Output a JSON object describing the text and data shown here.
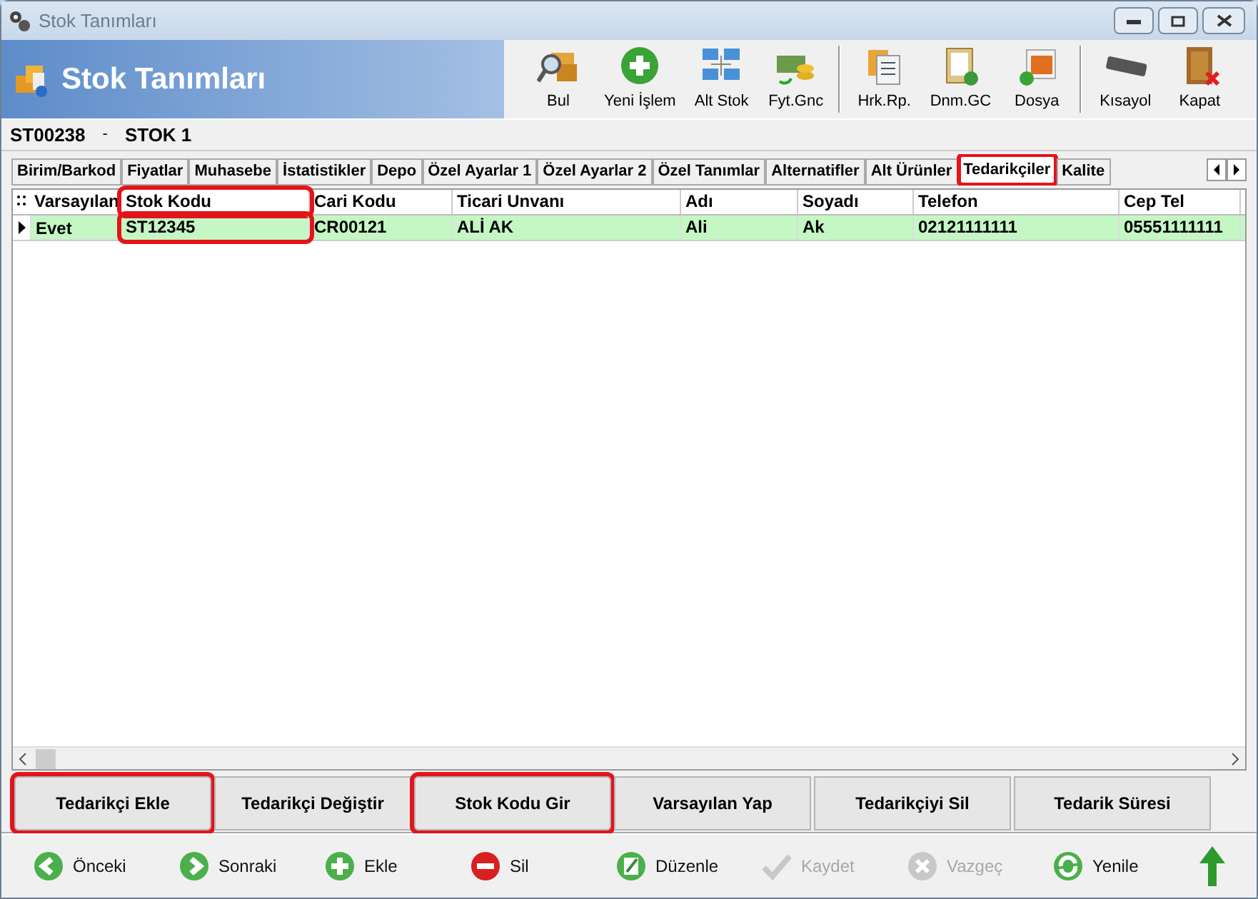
{
  "window": {
    "title": "Stok Tanımları"
  },
  "header": {
    "title": "Stok Tanımları"
  },
  "toolbar": [
    {
      "label": "Bul"
    },
    {
      "label": "Yeni İşlem"
    },
    {
      "label": "Alt Stok"
    },
    {
      "label": "Fyt.Gnc"
    },
    {
      "label": "Hrk.Rp."
    },
    {
      "label": "Dnm.GC"
    },
    {
      "label": "Dosya"
    },
    {
      "label": "Kısayol"
    },
    {
      "label": "Kapat"
    }
  ],
  "record": {
    "code": "ST00238",
    "separator": "-",
    "name": "STOK 1"
  },
  "tabs": [
    {
      "label": "Birim/Barkod",
      "selected": false
    },
    {
      "label": "Fiyatlar",
      "selected": false
    },
    {
      "label": "Muhasebe",
      "selected": false
    },
    {
      "label": "İstatistikler",
      "selected": false
    },
    {
      "label": "Depo",
      "selected": false
    },
    {
      "label": "Özel Ayarlar 1",
      "selected": false
    },
    {
      "label": "Özel Ayarlar 2",
      "selected": false
    },
    {
      "label": "Özel Tanımlar",
      "selected": false
    },
    {
      "label": "Alternatifler",
      "selected": false
    },
    {
      "label": "Alt Ürünler",
      "selected": false
    },
    {
      "label": "Tedarikçiler",
      "selected": true,
      "highlighted": true
    },
    {
      "label": "Kalite",
      "selected": false
    }
  ],
  "table": {
    "columns": [
      {
        "label": "Varsayılan",
        "highlighted": false
      },
      {
        "label": "Stok Kodu",
        "highlighted": true
      },
      {
        "label": "Cari Kodu",
        "highlighted": false
      },
      {
        "label": "Ticari Unvanı",
        "highlighted": false
      },
      {
        "label": "Adı",
        "highlighted": false
      },
      {
        "label": "Soyadı",
        "highlighted": false
      },
      {
        "label": "Telefon",
        "highlighted": false
      },
      {
        "label": "Cep Tel",
        "highlighted": false
      }
    ],
    "rows": [
      {
        "selected": true,
        "cells": [
          "Evet",
          "ST12345",
          "CR00121",
          "ALİ AK",
          "Ali",
          "Ak",
          "02121111111",
          "05551111111"
        ]
      }
    ]
  },
  "actions": [
    {
      "label": "Tedarikçi Ekle",
      "highlighted": true
    },
    {
      "label": "Tedarikçi Değiştir",
      "highlighted": false
    },
    {
      "label": "Stok Kodu Gir",
      "highlighted": true
    },
    {
      "label": "Varsayılan Yap",
      "highlighted": false
    },
    {
      "label": "Tedarikçiyi Sil",
      "highlighted": false
    },
    {
      "label": "Tedarik Süresi",
      "highlighted": false
    }
  ],
  "navigation": [
    {
      "label": "Önceki",
      "disabled": false
    },
    {
      "label": "Sonraki",
      "disabled": false
    },
    {
      "label": "Ekle",
      "disabled": false
    },
    {
      "label": "Sil",
      "disabled": false
    },
    {
      "label": "Düzenle",
      "disabled": false
    },
    {
      "label": "Kaydet",
      "disabled": true
    },
    {
      "label": "Vazgeç",
      "disabled": true
    },
    {
      "label": "Yenile",
      "disabled": false
    }
  ]
}
